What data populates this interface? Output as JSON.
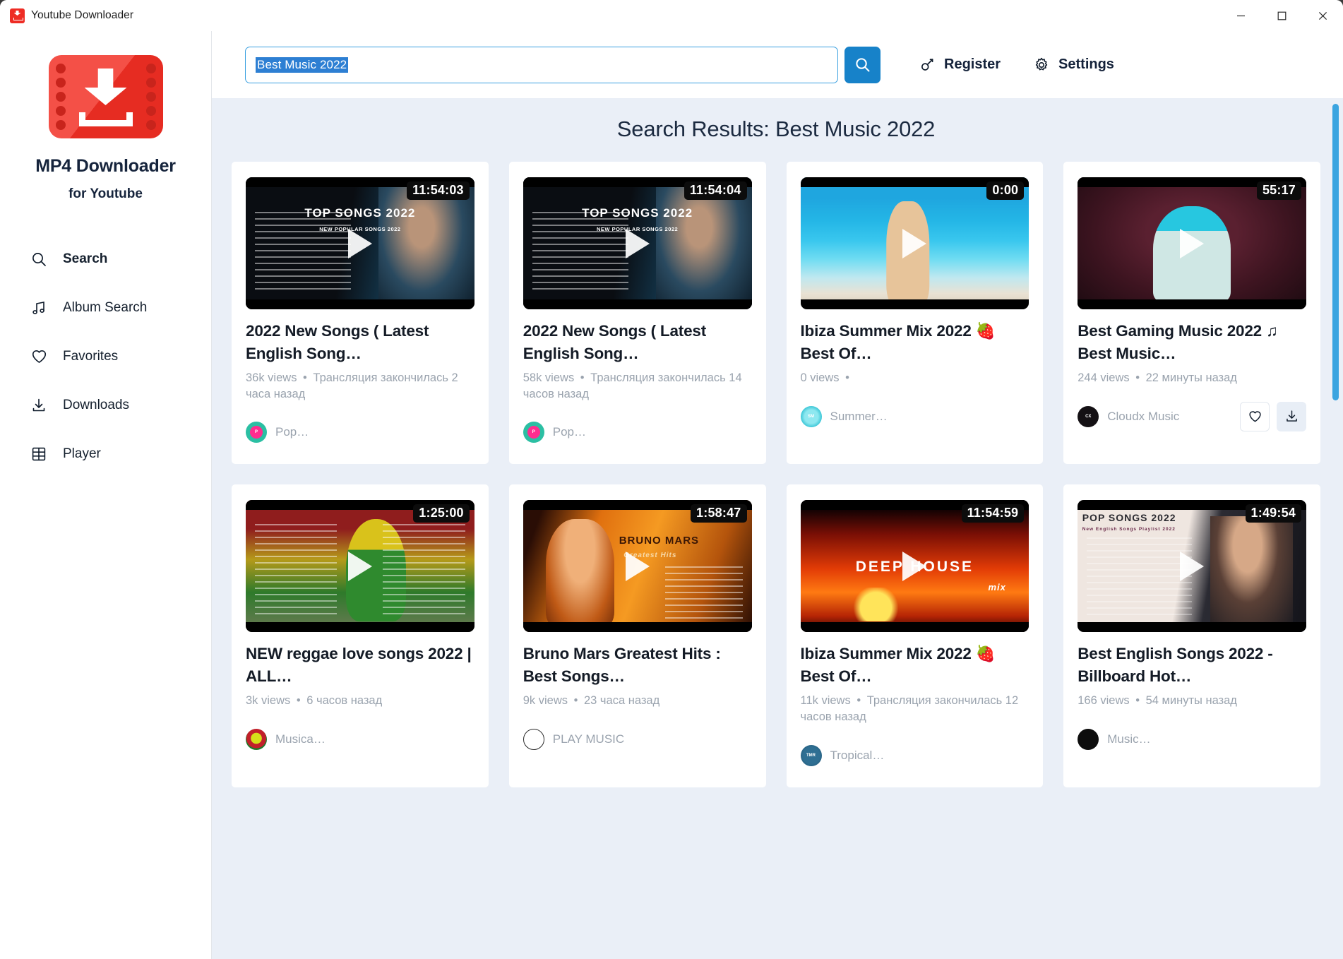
{
  "window": {
    "title": "Youtube Downloader",
    "controls": {
      "minimize": "minimize-icon",
      "maximize": "maximize-icon",
      "close": "close-icon"
    }
  },
  "sidebar": {
    "logo_icon": "mp4-downloader-logo",
    "brand": "MP4 Downloader",
    "brand_sub": "for Youtube",
    "items": [
      {
        "label": "Search",
        "icon": "search-icon",
        "active": true
      },
      {
        "label": "Album Search",
        "icon": "music-note-icon",
        "active": false
      },
      {
        "label": "Favorites",
        "icon": "heart-icon",
        "active": false
      },
      {
        "label": "Downloads",
        "icon": "download-icon",
        "active": false
      },
      {
        "label": "Player",
        "icon": "film-icon",
        "active": false
      }
    ]
  },
  "topbar": {
    "search_value": "Best Music 2022",
    "search_placeholder": "",
    "search_button_icon": "search-icon",
    "register": {
      "label": "Register",
      "icon": "key-icon"
    },
    "settings": {
      "label": "Settings",
      "icon": "gear-icon"
    }
  },
  "main": {
    "results_title": "Search Results: Best Music 2022",
    "accent_color": "#1782c9",
    "background": "#eaeff7",
    "scrollbar_color": "#3aa4e0"
  },
  "results": [
    {
      "title": "2022 New Songs ( Latest English Song…",
      "duration": "11:54:03",
      "views": "36k views",
      "age": "Трансляция закончилась 2 часа назад",
      "channel": "Pop…",
      "avatar": "av-pop",
      "avatar_text": "P",
      "art": "art-topsongs",
      "overlay": "TOP SONGS 2022",
      "overlay_sub": "NEW POPULAR SONGS 2022",
      "hovered": false
    },
    {
      "title": "2022 New Songs ( Latest English Song…",
      "duration": "11:54:04",
      "views": "58k views",
      "age": "Трансляция закончилась 14 часов назад",
      "channel": "Pop…",
      "avatar": "av-pop2",
      "avatar_text": "P",
      "art": "art-topsongs",
      "overlay": "TOP SONGS 2022",
      "overlay_sub": "NEW POPULAR SONGS 2022",
      "hovered": false
    },
    {
      "title": "Ibiza Summer Mix 2022 🍓 Best Of…",
      "duration": "0:00",
      "views": "0 views",
      "age": "",
      "channel": "Summer…",
      "avatar": "av-summer",
      "avatar_text": "SM",
      "art": "art-beach",
      "overlay": "",
      "overlay_sub": "",
      "hovered": false
    },
    {
      "title": "Best Gaming Music 2022 ♫ Best Music…",
      "duration": "55:17",
      "views": "244 views",
      "age": "22 минуты назад",
      "channel": "Cloudx Music",
      "avatar": "av-cloudx",
      "avatar_text": "CX",
      "art": "art-gaming",
      "overlay": "",
      "overlay_sub": "",
      "hovered": true,
      "actions": {
        "favorite": "heart-icon",
        "download": "download-icon"
      }
    },
    {
      "title": "NEW reggae love songs 2022 | ALL…",
      "duration": "1:25:00",
      "views": "3k views",
      "age": "6 часов назад",
      "channel": "Musica…",
      "avatar": "av-music",
      "avatar_text": "",
      "art": "art-reggae",
      "overlay": "",
      "overlay_sub": "",
      "hovered": false
    },
    {
      "title": "Bruno Mars Greatest Hits : Best Songs…",
      "duration": "1:58:47",
      "views": "9k views",
      "age": "23 часа назад",
      "channel": "PLAY MUSIC",
      "avatar": "av-play",
      "avatar_text": "",
      "art": "art-bruno",
      "overlay": "BRUNO MARS",
      "overlay_sub": "Greatest Hits",
      "hovered": false
    },
    {
      "title": "Ibiza Summer Mix 2022 🍓 Best Of…",
      "duration": "11:54:59",
      "views": "11k views",
      "age": "Трансляция закончилась 12 часов назад",
      "channel": "Tropical…",
      "avatar": "av-trop",
      "avatar_text": "TMR",
      "art": "art-deephouse",
      "overlay": "DEEP HOUSE",
      "overlay_sub": "mix",
      "hovered": false
    },
    {
      "title": "Best English Songs 2022 - Billboard Hot…",
      "duration": "1:49:54",
      "views": "166 views",
      "age": "54 минуты назад",
      "channel": "Music…",
      "avatar": "av-music2",
      "avatar_text": "",
      "art": "art-pop",
      "overlay": "POP SONGS 2022",
      "overlay_sub": "New English Songs Playlist 2022",
      "hovered": false
    }
  ]
}
